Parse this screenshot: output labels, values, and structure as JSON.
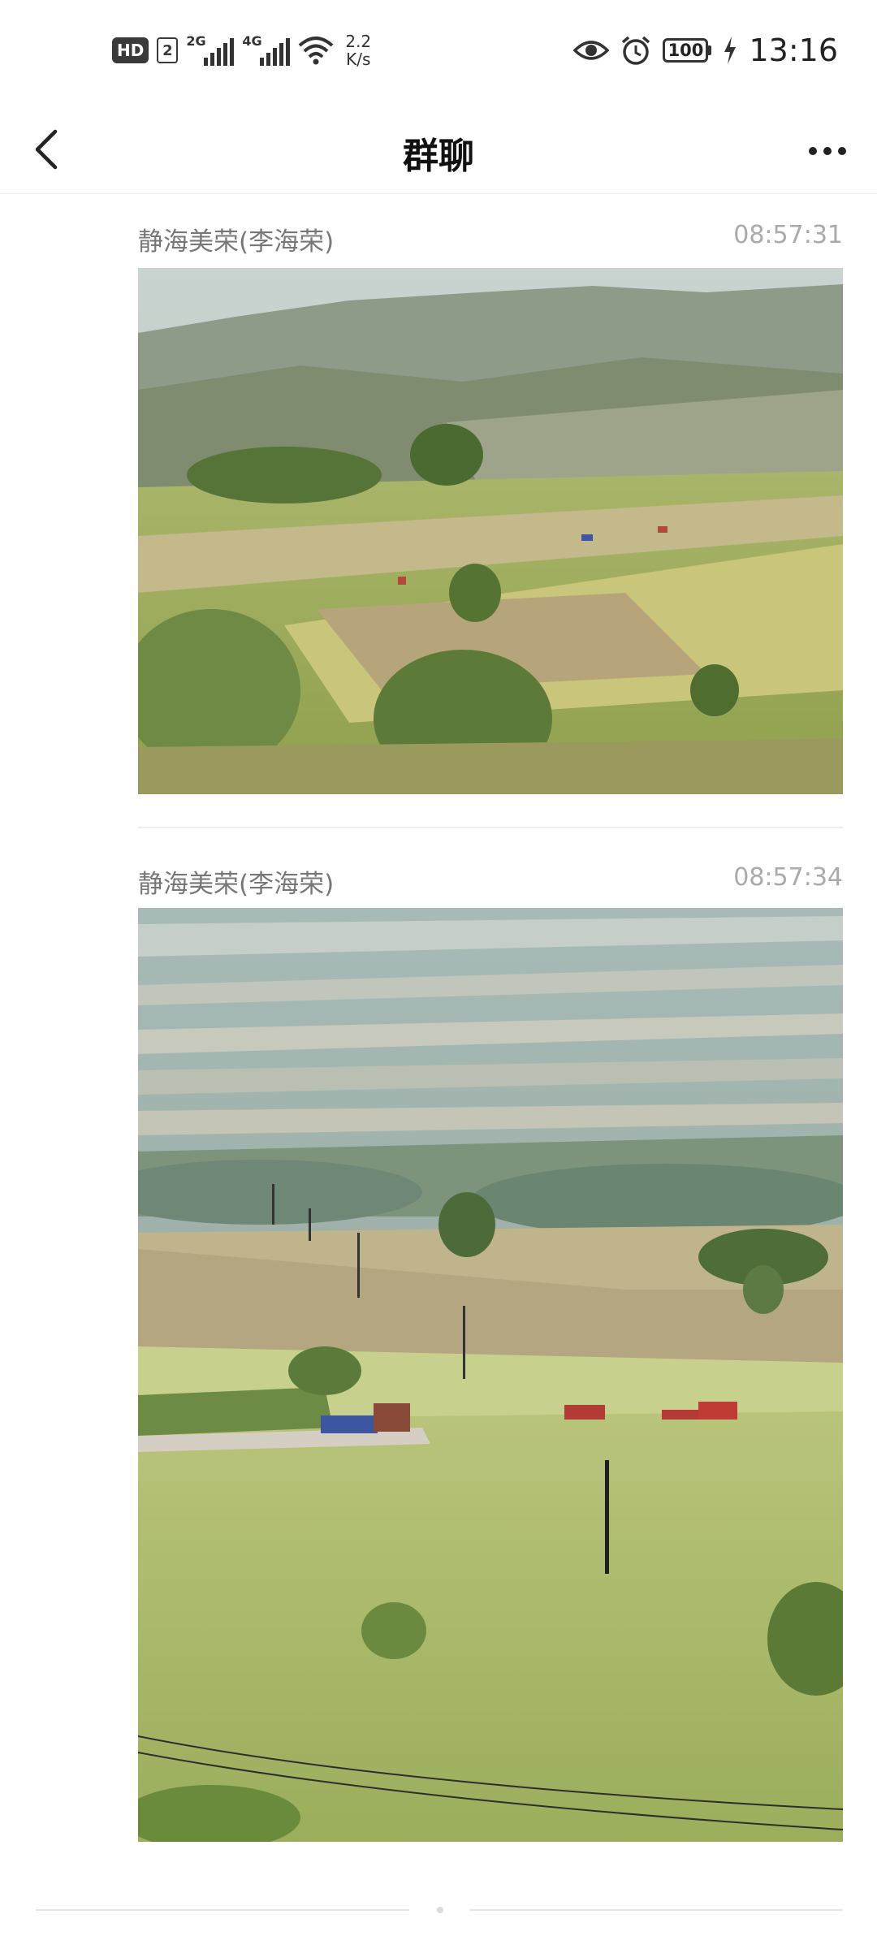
{
  "status_bar": {
    "hd": "HD",
    "sim": "2",
    "net1": "2G",
    "net2": "4G",
    "speed_value": "2.2",
    "speed_unit": "K/s",
    "battery": "100",
    "time": "13:16"
  },
  "header": {
    "title": "群聊"
  },
  "messages": [
    {
      "sender": "静海美荣(李海荣)",
      "time": "08:57:31"
    },
    {
      "sender": "静海美荣(李海荣)",
      "time": "08:57:34"
    }
  ],
  "colors": {
    "sender": "#777777",
    "timestamp": "#aaaaaa",
    "divider": "#eeeeee"
  },
  "icons": [
    "wifi-icon",
    "eye-icon",
    "alarm-icon",
    "charging-icon",
    "back-arrow-icon",
    "more-icon"
  ]
}
